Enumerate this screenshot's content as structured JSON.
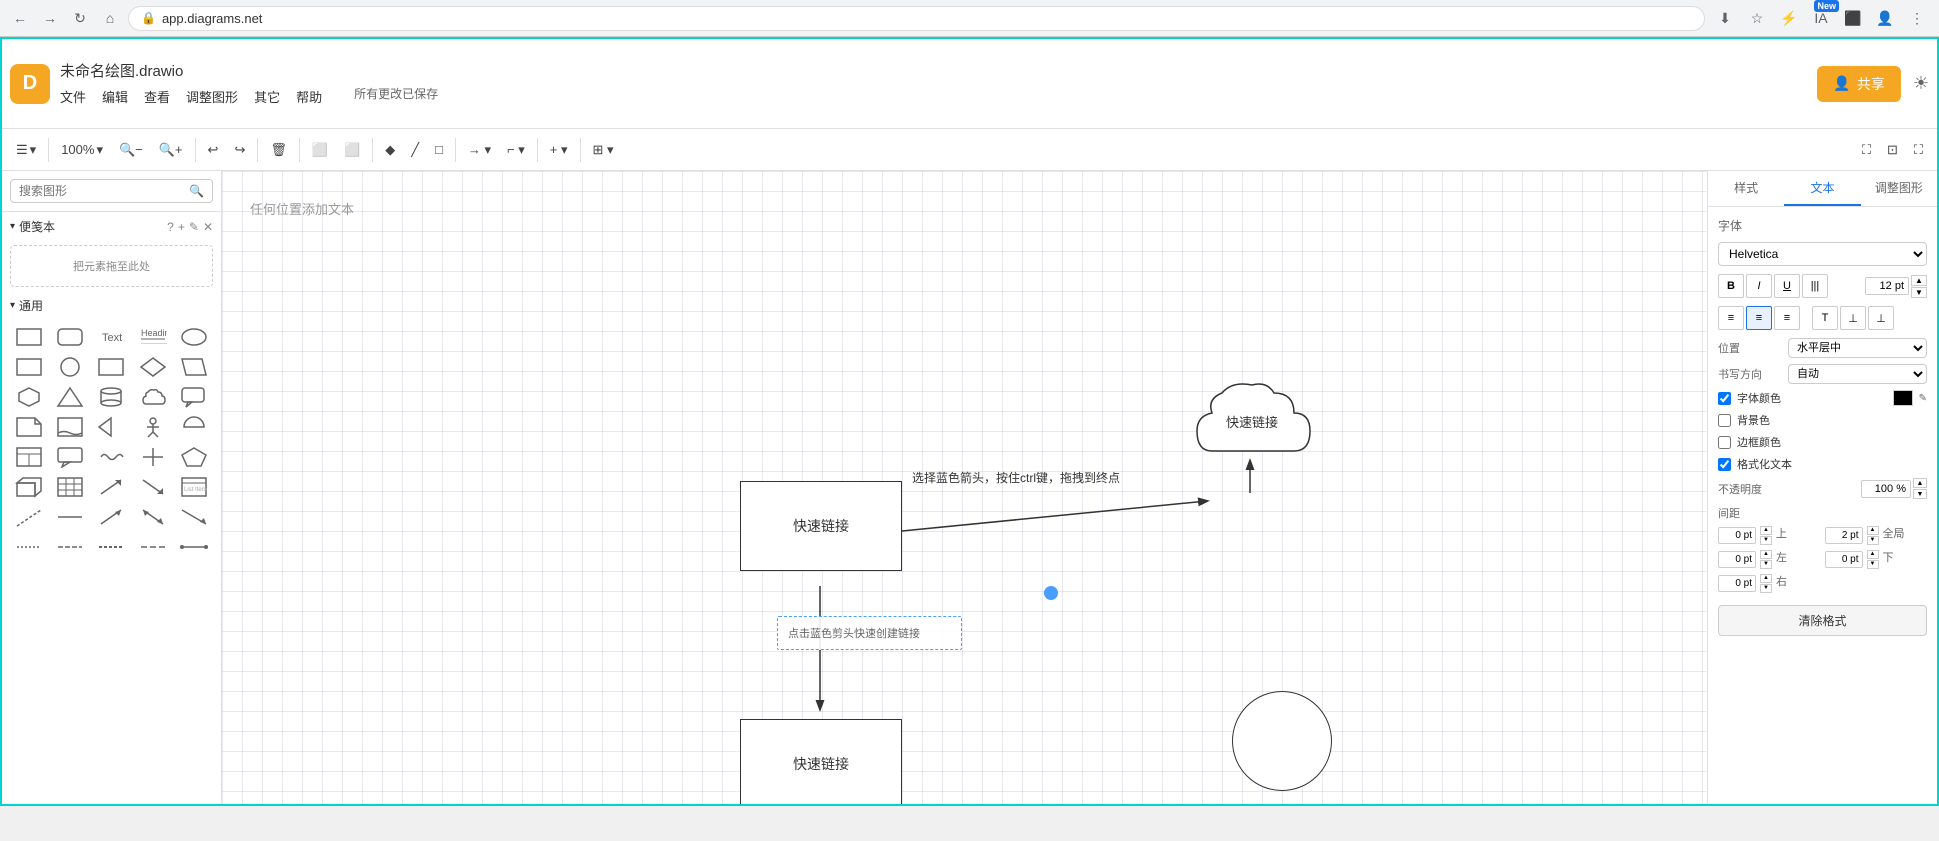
{
  "browser": {
    "back_btn": "←",
    "forward_btn": "→",
    "refresh_btn": "↻",
    "home_btn": "⌂",
    "url": "app.diagrams.net",
    "new_badge": "New"
  },
  "app": {
    "logo_text": "D",
    "title": "未命名绘图.drawio",
    "menu": {
      "file": "文件",
      "edit": "编辑",
      "view": "查看",
      "arrange": "调整图形",
      "other": "其它",
      "help": "帮助"
    },
    "save_status": "所有更改已保存",
    "share_btn": "共享",
    "settings_icon": "☀"
  },
  "toolbar": {
    "sidebar_toggle": "☰",
    "zoom": "100%",
    "zoom_out": "−",
    "zoom_in": "+",
    "undo": "↩",
    "redo": "↪",
    "delete": "⌫",
    "copy_style": "⬜",
    "paste_style": "⬜",
    "fill_color": "◆",
    "line_color": "/",
    "shape_outline": "□",
    "connection": "→",
    "waypoint": "⌐",
    "add": "+",
    "table": "⊞",
    "expand_btn": "⛶",
    "restore_btn": "⊡",
    "fullscreen_btn": "⛶"
  },
  "left_panel": {
    "search_placeholder": "搜索图形",
    "notepad_section": "便笺本",
    "help_icon": "?",
    "add_icon": "+",
    "edit_icon": "✎",
    "close_icon": "✕",
    "drop_zone_text": "把元素拖至此处",
    "general_section": "通用"
  },
  "canvas": {
    "hint_text": "任何位置添加文本",
    "box1_text": "快速链接",
    "box2_text": "快速链接",
    "cloud_text": "快速链接",
    "arrow_label": "选择蓝色箭头，按住ctrl键，拖拽到终点",
    "tooltip_text": "点击蓝色剪头快速创建链接"
  },
  "right_panel": {
    "tab_style": "样式",
    "tab_text": "文本",
    "tab_arrange": "调整图形",
    "font_section": "字体",
    "font_name": "Helvetica",
    "font_size": "12 pt",
    "bold": "B",
    "italic": "I",
    "underline": "U",
    "strikethrough": "|||",
    "align_left": "≡",
    "align_center": "≡",
    "align_right": "≡",
    "valign_top": "T",
    "valign_middle": "⊥",
    "valign_bottom": "⊥",
    "position_label": "位置",
    "position_value": "水平层中",
    "writing_dir_label": "书写方向",
    "writing_dir_value": "自动",
    "font_color_label": "字体颜色",
    "bg_color_label": "背景色",
    "border_color_label": "边框颜色",
    "formatted_text_label": "格式化文本",
    "opacity_label": "不透明度",
    "opacity_value": "100 %",
    "spacing_label": "间距",
    "spacing_top": "0 pt",
    "spacing_global": "2 pt",
    "spacing_left": "0 pt",
    "spacing_bottom": "0 pt",
    "spacing_right": "0 pt",
    "spacing_top_label": "上",
    "spacing_global_label": "全局",
    "spacing_left_label": "左",
    "spacing_bottom_label": "下",
    "spacing_right_label": "右",
    "clear_format_btn": "清除格式"
  }
}
